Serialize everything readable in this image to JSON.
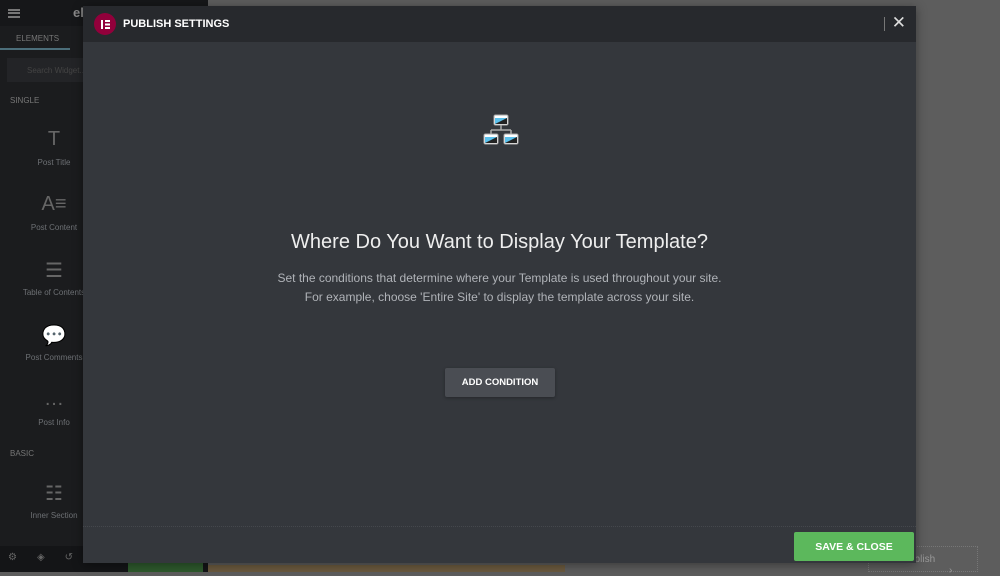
{
  "sidebar": {
    "logo": "el",
    "tab": "ELEMENTS",
    "search_placeholder": "Search Widget...",
    "sections": [
      {
        "label": "SINGLE",
        "items": [
          {
            "label": "Post Title",
            "icon": "T"
          },
          {
            "label": "Post Content",
            "icon": "A≡"
          },
          {
            "label": "Table of Contents",
            "icon": "☰"
          },
          {
            "label": "Post Comments",
            "icon": "💬"
          },
          {
            "label": "Post Info",
            "icon": "…"
          }
        ]
      },
      {
        "label": "BASIC",
        "items": [
          {
            "label": "Inner Section",
            "icon": "☷"
          }
        ]
      }
    ],
    "footer_icons": [
      "gear-icon",
      "layers-icon",
      "history-icon"
    ]
  },
  "background": {
    "publish_label": "ublish",
    "chevron": "›"
  },
  "modal": {
    "title": "PUBLISH SETTINGS",
    "close": "✕",
    "heading": "Where Do You Want to Display Your Template?",
    "desc_line1": "Set the conditions that determine where your Template is used throughout your site.",
    "desc_line2": "For example, choose 'Entire Site' to display the template across your site.",
    "add_condition": "ADD CONDITION",
    "save_close": "SAVE & CLOSE",
    "colors": {
      "brand": "#92003b",
      "save": "#5cb85c"
    }
  }
}
